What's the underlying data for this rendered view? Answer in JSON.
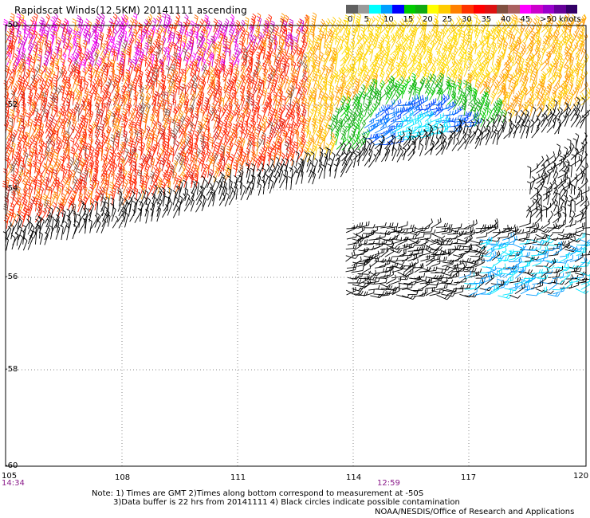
{
  "title": "Rapidscat Winds(12.5KM) 20141111 ascending",
  "scale": {
    "labels": [
      "0",
      "5",
      "10",
      "15",
      "20",
      "25",
      "30",
      "35",
      "40",
      "45",
      ">50 knots"
    ],
    "colors": [
      "#606060",
      "#9a9a9a",
      "#00ffff",
      "#00a0ff",
      "#0000ff",
      "#00cc00",
      "#11aa11",
      "#ffff00",
      "#ffcc00",
      "#ff8000",
      "#ff3300",
      "#ff0000",
      "#dd1111",
      "#805040",
      "#aa6060",
      "#ff00ff",
      "#cc00cc",
      "#9900cc",
      "#660099",
      "#330066"
    ]
  },
  "axes": {
    "lat_labels": [
      "-50",
      "-52",
      "-54",
      "-56",
      "-58",
      "-60"
    ],
    "lon_labels": [
      "105",
      "108",
      "111",
      "114",
      "117",
      "120"
    ]
  },
  "times": {
    "left": "14:34",
    "center": "12:59"
  },
  "notes": [
    "Note: 1) Times are GMT 2)Times along bottom correspond to measurement at -50S",
    "3)Data buffer is 22 hrs from 20141111 4) Black circles indicate possible contamination"
  ],
  "credit": "NOAA/NESDIS/Office of Research and Applications",
  "colors": {
    "grid": "#888888",
    "time_text": "#8a1a8a",
    "background": "#ffffff"
  }
}
